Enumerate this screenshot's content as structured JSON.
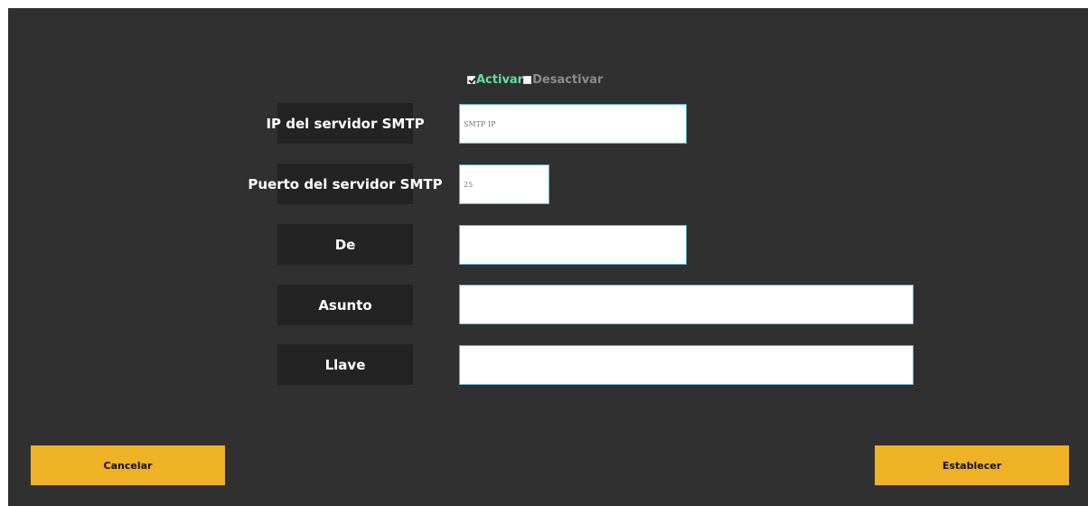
{
  "toggle": {
    "activate_label": "Activar",
    "deactivate_label": "Desactivar",
    "selected": "Activar"
  },
  "fields": {
    "smtp_ip": {
      "label": "IP del servidor SMTP",
      "value": "",
      "placeholder": "SMTP IP"
    },
    "smtp_port": {
      "label": "Puerto del servidor SMTP",
      "value": "",
      "placeholder": "25"
    },
    "from": {
      "label": "De",
      "value": "",
      "placeholder": ""
    },
    "subject": {
      "label": "Asunto",
      "value": "",
      "placeholder": ""
    },
    "key": {
      "label": "Llave",
      "value": "",
      "placeholder": ""
    }
  },
  "buttons": {
    "cancel": "Cancelar",
    "set": "Establecer"
  },
  "colors": {
    "background": "#303030",
    "label_bg": "#232323",
    "accent_button": "#efb125",
    "active_toggle": "#5ee39a",
    "input_border": "#5bb5d6"
  }
}
